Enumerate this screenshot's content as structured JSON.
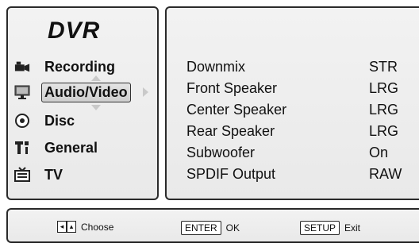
{
  "menu": {
    "title": "DVR",
    "items": [
      {
        "label": "Recording",
        "icon": "camera-icon",
        "active": false
      },
      {
        "label": "Audio/Video",
        "icon": "monitor-icon",
        "active": true
      },
      {
        "label": "Disc",
        "icon": "disc-icon",
        "active": false
      },
      {
        "label": "General",
        "icon": "general-settings-icon",
        "active": false
      },
      {
        "label": "TV",
        "icon": "tv-icon",
        "active": false
      }
    ]
  },
  "settings": [
    {
      "label": "Downmix",
      "value": "STR"
    },
    {
      "label": "Front Speaker",
      "value": "LRG"
    },
    {
      "label": "Center Speaker",
      "value": "LRG"
    },
    {
      "label": "Rear Speaker",
      "value": "LRG"
    },
    {
      "label": "Subwoofer",
      "value": "On"
    },
    {
      "label": "SPDIF Output",
      "value": "RAW"
    }
  ],
  "footer": {
    "choose_label": "Choose",
    "enter_key": "ENTER",
    "enter_label": "OK",
    "setup_key": "SETUP",
    "setup_label": "Exit",
    "nav_left": "◂",
    "nav_up": "▴"
  }
}
